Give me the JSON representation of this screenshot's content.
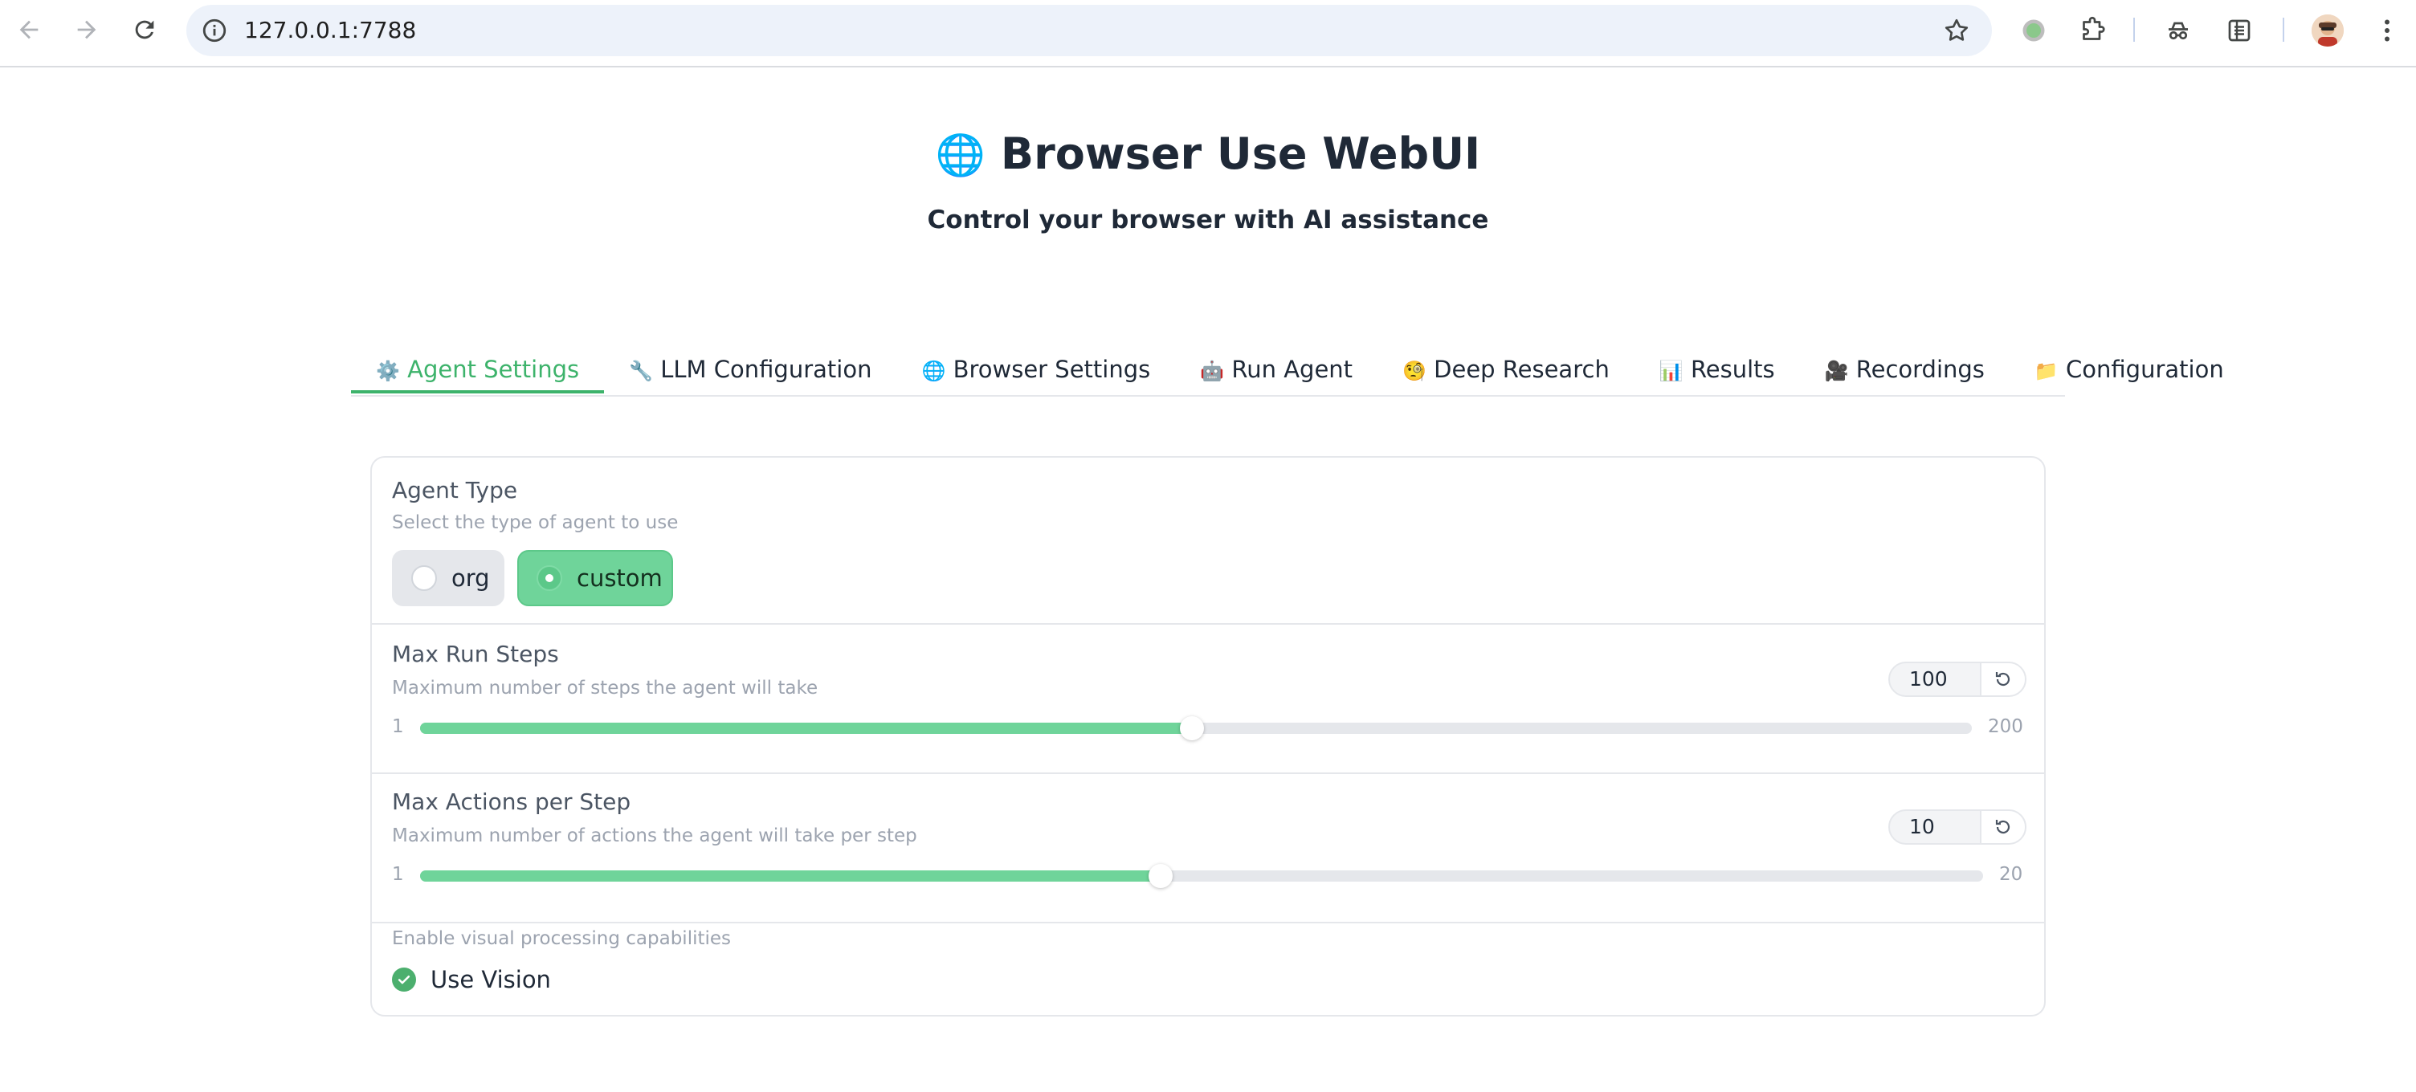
{
  "browser": {
    "url": "127.0.0.1:7788",
    "icons": [
      "back-arrow-icon",
      "forward-arrow-icon",
      "reload-icon",
      "site-info-icon",
      "bookmark-star-icon",
      "extension-status-icon",
      "extensions-puzzle-icon",
      "incognito-icon",
      "reading-list-icon",
      "profile-avatar",
      "menu-kebab-icon"
    ]
  },
  "header": {
    "title_icon": "🌐",
    "title": "Browser Use WebUI",
    "subtitle": "Control your browser with AI assistance"
  },
  "tabs": [
    {
      "icon": "⚙️",
      "label": "Agent Settings",
      "active": true
    },
    {
      "icon": "🔧",
      "label": "LLM Configuration",
      "active": false
    },
    {
      "icon": "🌐",
      "label": "Browser Settings",
      "active": false
    },
    {
      "icon": "🤖",
      "label": "Run Agent",
      "active": false
    },
    {
      "icon": "🧐",
      "label": "Deep Research",
      "active": false
    },
    {
      "icon": "📊",
      "label": "Results",
      "active": false
    },
    {
      "icon": "🎥",
      "label": "Recordings",
      "active": false
    },
    {
      "icon": "📁",
      "label": "Configuration",
      "active": false
    }
  ],
  "agent_settings": {
    "agent_type": {
      "label": "Agent Type",
      "info": "Select the type of agent to use",
      "options": [
        "org",
        "custom"
      ],
      "selected": "custom"
    },
    "max_run_steps": {
      "label": "Max Run Steps",
      "info": "Maximum number of steps the agent will take",
      "value": "100",
      "min": "1",
      "max": "200"
    },
    "max_actions_per_step": {
      "label": "Max Actions per Step",
      "info": "Maximum number of actions the agent will take per step",
      "value": "10",
      "min": "1",
      "max": "20"
    },
    "use_vision": {
      "info": "Enable visual processing capabilities",
      "label": "Use Vision",
      "checked": true
    }
  },
  "colors": {
    "accent": "#3db36b",
    "slider_fill": "#6fd49a",
    "selected_radio": "#6fd49a"
  }
}
